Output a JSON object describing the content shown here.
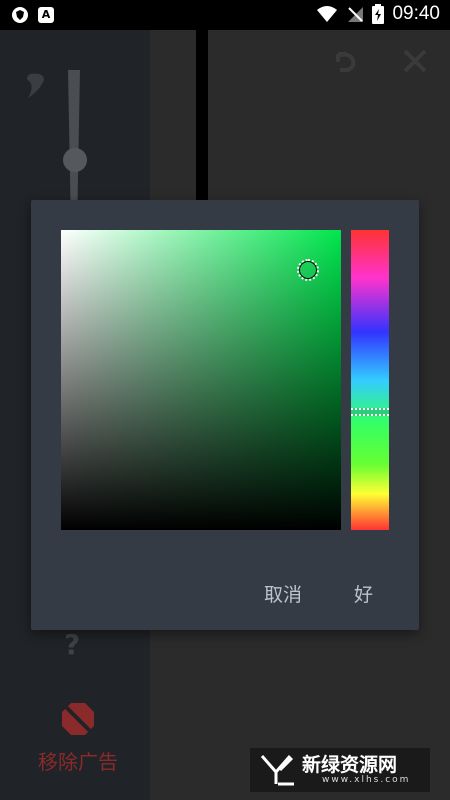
{
  "status_bar": {
    "time": "09:40",
    "left_icon_1": "shield-icon",
    "left_icon_2": "A",
    "right_icons": [
      "wifi-icon",
      "no-signal-icon",
      "battery-charging-icon"
    ]
  },
  "toolbar": {
    "undo_icon": "undo-icon",
    "close_icon": "close-icon"
  },
  "color_picker": {
    "selected_hue_color": "#00e64d",
    "cancel_label": "取消",
    "ok_label": "好"
  },
  "sidebar": {
    "help_symbol": "?",
    "remove_ads_label": "移除广告"
  },
  "watermark": {
    "name": "新绿资源网",
    "url": "www.xlhs.com"
  }
}
